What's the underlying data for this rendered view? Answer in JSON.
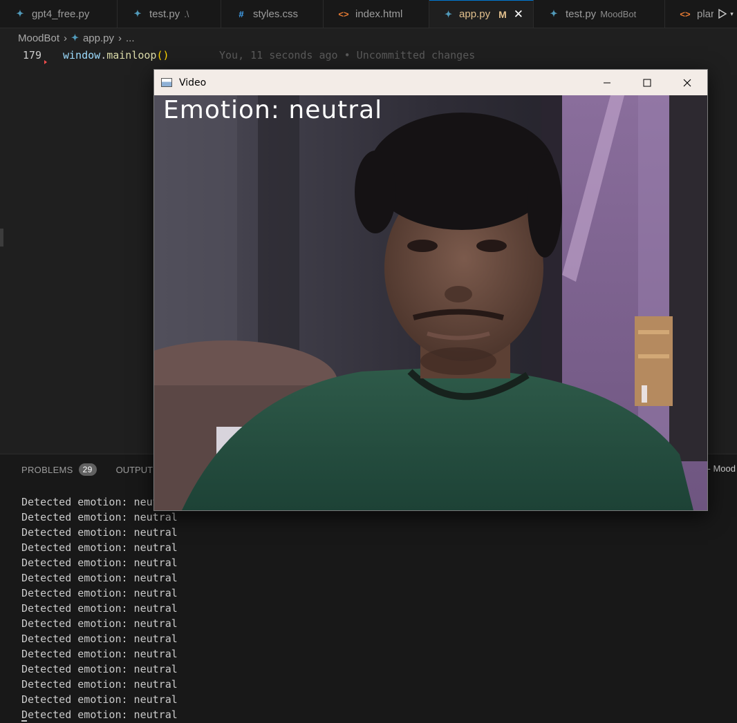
{
  "tabs": [
    {
      "label": "gpt4_free.py",
      "icon": "python-icon",
      "description": "",
      "active": false
    },
    {
      "label": "test.py",
      "icon": "python-icon",
      "description": ".\\",
      "active": false
    },
    {
      "label": "styles.css",
      "icon": "css-icon",
      "description": "",
      "active": false
    },
    {
      "label": "index.html",
      "icon": "html-icon",
      "description": "",
      "active": false
    },
    {
      "label": "app.py",
      "icon": "python-icon",
      "description": "",
      "active": true,
      "modified_marker": "M"
    },
    {
      "label": "test.py",
      "icon": "python-icon",
      "description": "MoodBot",
      "active": false
    },
    {
      "label": "plar",
      "icon": "html-icon",
      "description": "",
      "active": false
    }
  ],
  "breadcrumb": {
    "folder": "MoodBot",
    "file": "app.py",
    "more": "..."
  },
  "editor": {
    "line_number": "179",
    "code_object": "window",
    "code_dot": ".",
    "code_method": "mainloop",
    "code_parens": "()",
    "blame": "You, 11 seconds ago • Uncommitted changes"
  },
  "panel": {
    "problems_label": "PROBLEMS",
    "problems_count": "29",
    "output_label": "OUTPUT",
    "right_text": "- Mood",
    "terminal_lines": [
      "Detected emotion: neutral",
      "Detected emotion: neutral",
      "Detected emotion: neutral",
      "Detected emotion: neutral",
      "Detected emotion: neutral",
      "Detected emotion: neutral",
      "Detected emotion: neutral",
      "Detected emotion: neutral",
      "Detected emotion: neutral",
      "Detected emotion: neutral",
      "Detected emotion: neutral",
      "Detected emotion: neutral",
      "Detected emotion: neutral",
      "Detected emotion: neutral",
      "Detected emotion: neutral"
    ]
  },
  "video_window": {
    "title": "Video",
    "overlay_text": "Emotion: neutral"
  },
  "colors": {
    "active_tab_text": "#e2c08d",
    "editor_bg": "#1f1f1f",
    "panel_bg": "#181818",
    "titlebar_bg": "#f3ece7"
  }
}
